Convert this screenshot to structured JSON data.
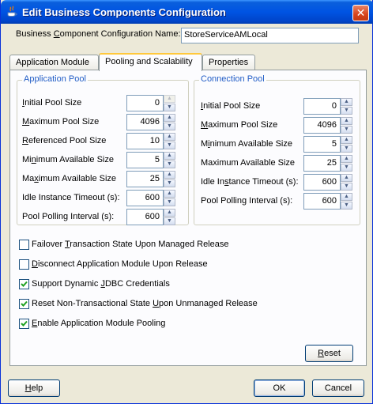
{
  "window": {
    "title": "Edit Business Components Configuration",
    "close_glyph": "✕"
  },
  "config_name": {
    "label_pre": "Business ",
    "label_mn": "C",
    "label_post": "omponent Configuration Name:",
    "value": "StoreServiceAMLocal"
  },
  "tabs": [
    {
      "label": "Application Module"
    },
    {
      "label": "Pooling and Scalability"
    },
    {
      "label": "Properties"
    }
  ],
  "application_pool": {
    "title": "Application Pool",
    "fields": [
      {
        "pre": "",
        "mn": "I",
        "post": "nitial Pool Size",
        "value": "0"
      },
      {
        "pre": "",
        "mn": "M",
        "post": "aximum Pool Size",
        "value": "4096"
      },
      {
        "pre": "",
        "mn": "R",
        "post": "eferenced Pool Size",
        "value": "10"
      },
      {
        "pre": "Mi",
        "mn": "n",
        "post": "imum Available Size",
        "value": "5"
      },
      {
        "pre": "Ma",
        "mn": "x",
        "post": "imum Available Size",
        "value": "25"
      },
      {
        "pre": "Idle Instance Timeout (s):",
        "mn": "",
        "post": "",
        "value": "600"
      },
      {
        "pre": "Pool Polling Interval (s):",
        "mn": "",
        "post": "",
        "value": "600"
      }
    ]
  },
  "connection_pool": {
    "title": "Connection Pool",
    "fields": [
      {
        "pre": "",
        "mn": "I",
        "post": "nitial Pool Size",
        "value": "0"
      },
      {
        "pre": "",
        "mn": "M",
        "post": "aximum Pool Size",
        "value": "4096"
      },
      {
        "pre": "M",
        "mn": "i",
        "post": "nimum Available Size",
        "value": "5"
      },
      {
        "pre": "Maximum Available Size",
        "mn": "",
        "post": "",
        "value": "25"
      },
      {
        "pre": "Idle In",
        "mn": "s",
        "post": "tance Timeout (s):",
        "value": "600"
      },
      {
        "pre": "Pool Polling Interval (s):",
        "mn": "",
        "post": "",
        "value": "600"
      }
    ]
  },
  "checkboxes": [
    {
      "pre": "Failover ",
      "mn": "T",
      "post": "ransaction State Upon Managed Release",
      "checked": false
    },
    {
      "pre": "",
      "mn": "D",
      "post": "isconnect Application Module Upon Release",
      "checked": false
    },
    {
      "pre": "Support Dynamic ",
      "mn": "J",
      "post": "DBC Credentials",
      "checked": true
    },
    {
      "pre": "Reset Non-Transactional State ",
      "mn": "U",
      "post": "pon Unmanaged Release",
      "checked": true
    },
    {
      "pre": "",
      "mn": "E",
      "post": "nable Application Module Pooling",
      "checked": true
    }
  ],
  "buttons": {
    "reset": {
      "mn": "R",
      "post": "eset"
    },
    "help": {
      "mn": "H",
      "post": "elp"
    },
    "ok": "OK",
    "cancel": "Cancel"
  }
}
